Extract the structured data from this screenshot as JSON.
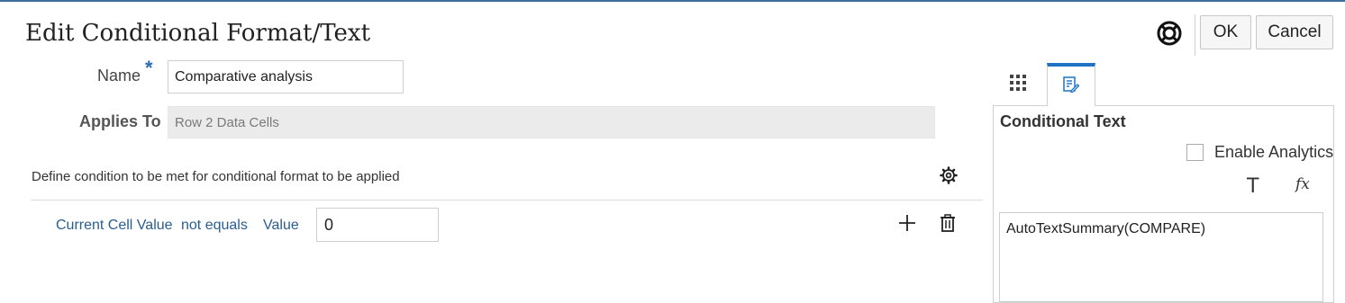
{
  "dialog": {
    "title": "Edit Conditional Format/Text",
    "ok_label": "OK",
    "cancel_label": "Cancel"
  },
  "form": {
    "name_label": "Name",
    "required_marker": "*",
    "name_value": "Comparative analysis",
    "applies_label": "Applies To",
    "applies_value": "Row 2 Data Cells"
  },
  "condition": {
    "instruction": "Define condition to be met for conditional format to be applied",
    "left_operand": "Current Cell Value",
    "operator": "not equals",
    "right_type": "Value",
    "value": "0"
  },
  "side_panel": {
    "title": "Conditional Text",
    "enable_analytics_label": "Enable Analytics",
    "enable_analytics_checked": false,
    "text_icon": "T",
    "fx_icon": "fx",
    "text_value": "AutoTextSummary(COMPARE)",
    "active_tab": "conditional-text"
  },
  "colors": {
    "accent": "#1f72c4",
    "link": "#2a5d8f",
    "required": "#2b6cb0"
  }
}
